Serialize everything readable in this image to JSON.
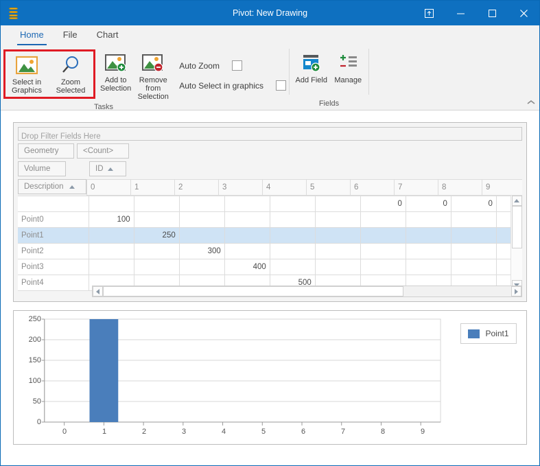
{
  "window": {
    "title": "Pivot: New Drawing",
    "app_icon": "database-icon",
    "buttons": [
      {
        "name": "restore-up-button",
        "label": "⬆"
      },
      {
        "name": "minimize-button",
        "label": "—"
      },
      {
        "name": "maximize-button",
        "label": "☐"
      },
      {
        "name": "close-button",
        "label": "✕"
      }
    ]
  },
  "tabs": [
    {
      "label": "Home",
      "active": true
    },
    {
      "label": "File",
      "active": false
    },
    {
      "label": "Chart",
      "active": false
    }
  ],
  "ribbon": {
    "tasks": {
      "group_label": "Tasks",
      "select_in_graphics": "Select in\nGraphics",
      "select_in_graphics_line1": "Select in",
      "select_in_graphics_line2": "Graphics",
      "zoom_selected": "Zoom Selected",
      "add_to_selection_line1": "Add to",
      "add_to_selection_line2": "Selection",
      "remove_from_selection_line1": "Remove from",
      "remove_from_selection_line2": "Selection",
      "auto_zoom_label": "Auto Zoom",
      "auto_zoom_checked": false,
      "auto_select_label": "Auto Select in graphics",
      "auto_select_checked": false,
      "highlight_color": "#e01b24"
    },
    "fields": {
      "group_label": "Fields",
      "add_field": "Add Field",
      "manage": "Manage"
    },
    "collapse_icon": "chevron-up-icon"
  },
  "pivot": {
    "filter_drop_text": "Drop Filter Fields Here",
    "field_buttons_row1": [
      "Geometry",
      "<Count>"
    ],
    "field_buttons_row2": [
      "Volume",
      "ID"
    ],
    "row_field_label": "Description",
    "column_headers": [
      "0",
      "1",
      "2",
      "3",
      "4",
      "5",
      "6",
      "7",
      "8",
      "9"
    ],
    "rows": [
      {
        "label": "",
        "cells": [
          "",
          "",
          "",
          "",
          "",
          "",
          "0",
          "0",
          "0",
          ""
        ],
        "selected": false,
        "total": true
      },
      {
        "label": "Point0",
        "cells": [
          "100",
          "",
          "",
          "",
          "",
          "",
          "",
          "",
          "",
          ""
        ],
        "selected": false
      },
      {
        "label": "Point1",
        "cells": [
          "",
          "250",
          "",
          "",
          "",
          "",
          "",
          "",
          "",
          ""
        ],
        "selected": true,
        "focus_col": 0
      },
      {
        "label": "Point2",
        "cells": [
          "",
          "",
          "300",
          "",
          "",
          "",
          "",
          "",
          "",
          ""
        ],
        "selected": false
      },
      {
        "label": "Point3",
        "cells": [
          "",
          "",
          "",
          "400",
          "",
          "",
          "",
          "",
          "",
          ""
        ],
        "selected": false
      },
      {
        "label": "Point4",
        "cells": [
          "",
          "",
          "",
          "",
          "500",
          "",
          "",
          "",
          "",
          ""
        ],
        "selected": false
      }
    ]
  },
  "chart_data": {
    "type": "bar",
    "title": "",
    "xlabel": "",
    "ylabel": "",
    "categories": [
      "0",
      "1",
      "2",
      "3",
      "4",
      "5",
      "6",
      "7",
      "8",
      "9"
    ],
    "series": [
      {
        "name": "Point1",
        "color": "#4a7ebb",
        "values": [
          0,
          250,
          0,
          0,
          0,
          0,
          0,
          0,
          0,
          0
        ]
      }
    ],
    "ylim": [
      0,
      250
    ],
    "yticks": [
      "250",
      "200",
      "150",
      "100",
      "50",
      "0"
    ],
    "xticks": [
      "0",
      "1",
      "2",
      "3",
      "4",
      "5",
      "6",
      "7",
      "8",
      "9"
    ],
    "grid": true,
    "legend_position": "right",
    "legend": [
      "Point1"
    ]
  },
  "colors": {
    "titlebar": "#0e70c0",
    "accent": "#1d68b3",
    "bar": "#4a7ebb",
    "selection": "#cfe3f5",
    "highlight": "#e01b24"
  }
}
